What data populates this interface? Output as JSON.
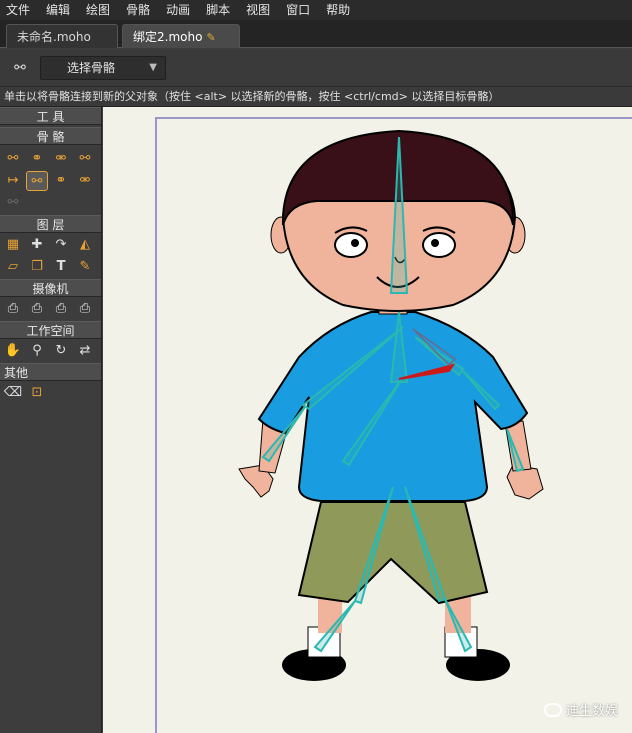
{
  "menubar": {
    "items": [
      "文件",
      "编辑",
      "绘图",
      "骨骼",
      "动画",
      "脚本",
      "视图",
      "窗口",
      "帮助"
    ]
  },
  "tabs": [
    {
      "label": "未命名.moho"
    },
    {
      "label": "绑定2.moho"
    }
  ],
  "tool_options": {
    "mode_select_value": "选择骨骼"
  },
  "status": {
    "text": "单击以将骨骼连接到新的父对象（按住 <alt> 以选择新的骨骼，按住 <ctrl/cmd> 以选择目标骨骼）"
  },
  "toolbox": {
    "sections": {
      "tools": "工 具",
      "bones": "骨 骼",
      "layer": "图 层",
      "camera": "摄像机",
      "workspace": "工作空间",
      "other": "其他"
    },
    "icons": {
      "bone_tools": [
        "select-bone-icon",
        "add-bone-icon",
        "transform-bone-icon",
        "manipulate-bones-icon",
        "reparent-bone-icon",
        "bone-strength-icon",
        "offset-bone-icon",
        "bind-layer-icon",
        "bind-points-icon"
      ],
      "layer_tools": [
        "set-origin-icon",
        "transform-layer-icon",
        "rotate-layer-icon",
        "scale-layer-icon",
        "shear-layer-icon",
        "switch-layer-icon",
        "text-icon",
        "eyedropper-icon"
      ],
      "camera_tools": [
        "track-camera-icon",
        "zoom-camera-icon",
        "roll-camera-icon",
        "pan-tilt-camera-icon"
      ],
      "workspace_tools": [
        "hand-icon",
        "magnifier-icon",
        "rotate-workspace-icon",
        "reset-view-icon"
      ],
      "other_tools": [
        "eraser-icon",
        "lock-icon"
      ]
    }
  },
  "watermark": {
    "text": "迪生数娱"
  },
  "colors": {
    "accent": "#e8a235",
    "canvas_bg": "#f2f2e8",
    "shirt": "#1a9de0",
    "shorts": "#8f9a5a",
    "hair": "#3a1018",
    "skin": "#f0b49c",
    "bone": "#2ab8b0",
    "selected_bone": "#cc1a1a"
  }
}
